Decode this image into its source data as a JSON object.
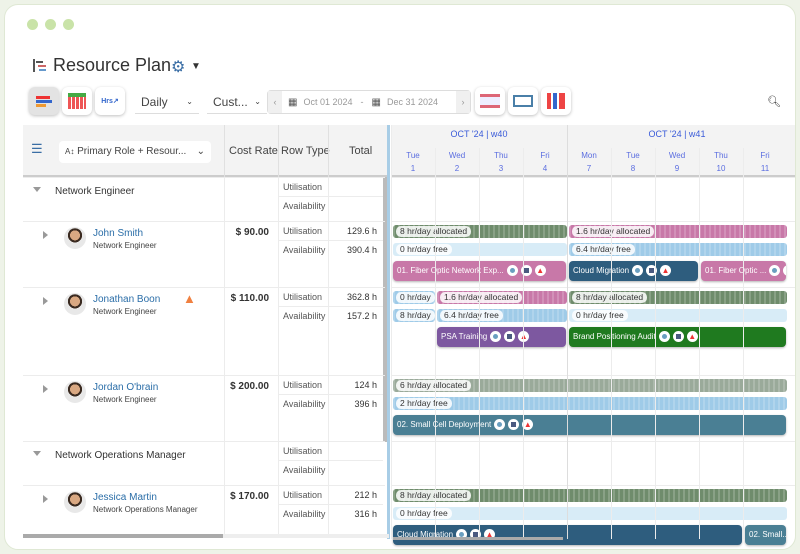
{
  "header": {
    "title": "Resource Plan"
  },
  "toolbar": {
    "view": "Daily",
    "range": "Cust...",
    "start_date": "Oct 01 2024",
    "sep": "-",
    "end_date": "Dec 31 2024"
  },
  "grid": {
    "group_by": "Primary Role + Resour...",
    "cols": [
      "Cost Rate",
      "Row Type",
      "Total"
    ]
  },
  "timeline": {
    "weeks": [
      {
        "label": "OCT '24 | w40",
        "days": [
          [
            "Tue",
            "1"
          ],
          [
            "Wed",
            "2"
          ],
          [
            "Thu",
            "3"
          ],
          [
            "Fri",
            "4"
          ]
        ]
      },
      {
        "label": "OCT '24 | w41",
        "days": [
          [
            "Mon",
            "7"
          ],
          [
            "Tue",
            "8"
          ],
          [
            "Wed",
            "9"
          ],
          [
            "Thu",
            "10"
          ],
          [
            "Fri",
            "11"
          ]
        ]
      }
    ]
  },
  "colors": {
    "green": "#6f8c6c",
    "pink": "#c878a8",
    "lightblue": "#d8ecf7",
    "blue": "#9fcbe8",
    "darkblue": "#2e5d7e",
    "purple": "#7d58a0",
    "taskgreen": "#1f7a1f",
    "teal": "#4a7f94",
    "grey": "#9aaa9a"
  },
  "rows": [
    {
      "type": "group",
      "label": "Network Engineer",
      "row_types": [
        "Utilisation",
        "Availability"
      ]
    },
    {
      "type": "resource",
      "name": "John Smith",
      "role": "Network Engineer",
      "cost": "$ 90.00",
      "row_types": [
        "Utilisation",
        "Availability"
      ],
      "totals": [
        "129.6 h",
        "390.4 h"
      ],
      "util": [
        {
          "label": "8 hr/day allocated",
          "from": 1,
          "to": 4,
          "color": "green"
        },
        {
          "label": "1.6 hr/day allocated",
          "from": 7,
          "to": 11,
          "color": "pink"
        }
      ],
      "avail": [
        {
          "label": "0 hr/day free",
          "from": 1,
          "to": 4,
          "color": "lightblue"
        },
        {
          "label": "6.4 hr/day free",
          "from": 7,
          "to": 11,
          "color": "blue"
        }
      ],
      "tasks": [
        {
          "label": "01. Fiber Optic Network Exp...",
          "from": 1,
          "to": 4,
          "color": "pink"
        },
        {
          "label": "Cloud Migration",
          "from": 7,
          "to": 9,
          "color": "darkblue"
        },
        {
          "label": "01. Fiber Optic ...",
          "from": 10,
          "to": 11,
          "color": "pink"
        }
      ]
    },
    {
      "type": "resource",
      "name": "Jonathan Boon",
      "role": "Network Engineer",
      "warning": true,
      "cost": "$ 110.00",
      "row_types": [
        "Utilisation",
        "Availability"
      ],
      "totals": [
        "362.8 h",
        "157.2 h"
      ],
      "util": [
        {
          "label": "0 hr/day",
          "from": 1,
          "to": 1,
          "color": "blue"
        },
        {
          "label": "1.6 hr/day allocated",
          "from": 2,
          "to": 4,
          "color": "pink"
        },
        {
          "label": "8 hr/day allocated",
          "from": 7,
          "to": 11,
          "color": "green"
        }
      ],
      "avail": [
        {
          "label": "8 hr/day",
          "from": 1,
          "to": 1,
          "color": "blue"
        },
        {
          "label": "6.4 hr/day free",
          "from": 2,
          "to": 4,
          "color": "blue"
        },
        {
          "label": "0 hr/day free",
          "from": 7,
          "to": 11,
          "color": "lightblue"
        }
      ],
      "tasks": [
        {
          "label": "PSA Training",
          "from": 2,
          "to": 4,
          "color": "purple"
        },
        {
          "label": "Brand Positioning Audit",
          "from": 7,
          "to": 11,
          "color": "taskgreen"
        }
      ]
    },
    {
      "type": "resource",
      "name": "Jordan O'brain",
      "role": "Network Engineer",
      "cost": "$ 200.00",
      "row_types": [
        "Utilisation",
        "Availability"
      ],
      "totals": [
        "124 h",
        "396 h"
      ],
      "util": [
        {
          "label": "6 hr/day allocated",
          "from": 1,
          "to": 11,
          "color": "grey"
        }
      ],
      "avail": [
        {
          "label": "2 hr/day free",
          "from": 1,
          "to": 11,
          "color": "blue"
        }
      ],
      "tasks": [
        {
          "label": "02. Small Cell Deployment",
          "from": 1,
          "to": 11,
          "color": "teal"
        }
      ]
    },
    {
      "type": "group",
      "label": "Network Operations Manager",
      "row_types": [
        "Utilisation",
        "Availability"
      ]
    },
    {
      "type": "resource",
      "name": "Jessica Martin",
      "role": "Network Operations Manager",
      "cost": "$ 170.00",
      "row_types": [
        "Utilisation",
        "Availability"
      ],
      "totals": [
        "212 h",
        "316 h"
      ],
      "util": [
        {
          "label": "8 hr/day allocated",
          "from": 1,
          "to": 11,
          "color": "green"
        }
      ],
      "avail": [
        {
          "label": "0 hr/day free",
          "from": 1,
          "to": 11,
          "color": "lightblue"
        }
      ],
      "tasks": [
        {
          "label": "Cloud Migration",
          "from": 1,
          "to": 10,
          "color": "darkblue"
        },
        {
          "label": "02. Small...",
          "from": 11,
          "to": 11,
          "color": "teal"
        }
      ]
    }
  ]
}
